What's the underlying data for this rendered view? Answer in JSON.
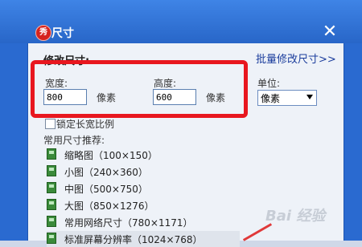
{
  "window": {
    "title": "尺寸",
    "app_icon_glyph": "秀"
  },
  "section": {
    "title": "修改尺寸:"
  },
  "batch_link": "批量修改尺寸>>",
  "width": {
    "label": "宽度:",
    "value": "800",
    "unit": "像素"
  },
  "height": {
    "label": "高度:",
    "value": "600",
    "unit": "像素"
  },
  "unit": {
    "label": "单位:",
    "selected": "像素"
  },
  "lock_ratio": {
    "label": "锁定长宽比例",
    "checked": false
  },
  "presets": {
    "label": "常用尺寸推荐:",
    "items": [
      "缩略图（100×150）",
      "小图（240×360）",
      "中图（500×750）",
      "大图（850×1276）",
      "常用网络尺寸（780×1171）",
      "标准屏幕分辨率（1024×768）"
    ]
  },
  "watermark": "Bai 经验",
  "colors": {
    "titlebar": "#2a6ad0",
    "highlight": "#e8171f",
    "link": "#1a3c9c"
  }
}
